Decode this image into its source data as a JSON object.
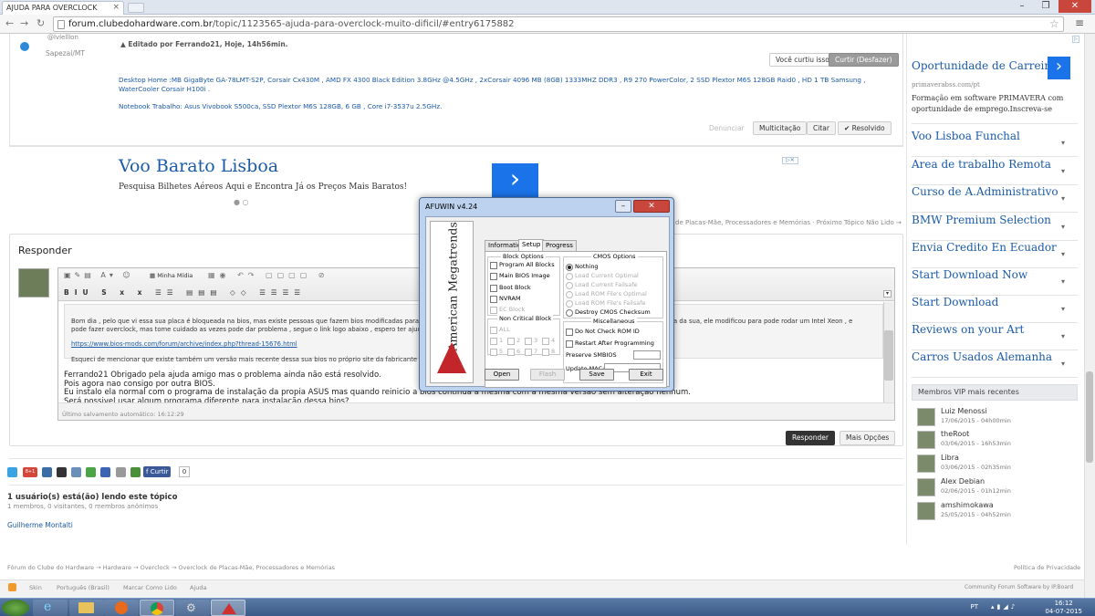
{
  "browser": {
    "tab_title": "AJUDA PARA OVERCLOCK",
    "url_host": "forum.clubedohardware.com.br",
    "url_path": "/topic/1123565-ajuda-para-overclock-muito-dificil/#entry6175882"
  },
  "post": {
    "user_fragment": "@lvlelllon",
    "location": "Sapezal/MT",
    "edited": "Editado por Ferrando21, Hoje, 14h56min.",
    "liked": "Você curtiu isso",
    "unlike": "Curtir (Desfazer)",
    "sig1": "Desktop Home :MB GigaByte GA-78LMT-S2P, Corsair Cx430M , AMD FX 4300 Black Edition 3.8GHz @4.5GHz , 2xCorsair 4096 MB (8GB) 1333MHZ DDR3 , R9 270 PowerColor, 2 SSD Plextor M6S 128GB Raid0 , HD 1 TB Samsung , WaterCooler Corsair H100i .",
    "sig2": "Notebook Trabalho: Asus Vivobook S500ca, SSD Plextor M6S 128GB, 6 GB , Core i7-3537u 2.5GHz.",
    "report": "Denunciar",
    "multiquote": "Multicitação",
    "quote": "Citar",
    "solved": "✔ Resolvido"
  },
  "ad1": {
    "title": "Voo Barato Lisboa",
    "text": "Pesquisa Bilhetes Aéreos Aqui e Encontra Já os Preços Mais Baratos!",
    "arrow": "›"
  },
  "nav_hint": "de Placas-Mãe, Processadores e Memórias · Próximo Tópico Não Lido →",
  "reply": {
    "heading": "Responder",
    "my_media": "Minha Mídia",
    "editor_p1": "Bom dia , pelo que vi essa sua placa é bloqueada na bios, mas existe pessoas que fazem bios modificadas para",
    "editor_p1b": "a da sua, ele modificou para pode rodar um Intel Xeon , e",
    "editor_p2": "pode fazer overclock, mas tome cuidado as vezes pode dar problema , segue o link logo abaixo , espero ter ajud",
    "editor_link": "https://www.bios-mods.com/forum/archive/index.php?thread-15676.html",
    "editor_p3": "Esqueci de mencionar que existe também um versão mais recente dessa sua bios no próprio site da fabricante d",
    "reply1": "Ferrando21 Obrigado pela ajuda amigo mas o problema ainda não está resolvido.",
    "reply2": "Pois agora nao consigo por outra BIOS.",
    "reply3": "Eu instalo ela normal com o programa de instalação da propia ASUS mas quando reinicio a bios continua a mesma com a mesma versão sem alteração nenhum.",
    "reply4": "Será possivel usar algum programa diferente para instalação dessa bios?",
    "autosave": "Último salvamento automático: 16:12:29",
    "submit": "Responder",
    "more": "Mais Opções"
  },
  "share": {
    "gplus": "8+1",
    "curtir": "Curtir",
    "count": "0"
  },
  "online": {
    "title": "1 usuário(s) está(ão) lendo este tópico",
    "detail": "1 membros, 0 visitantes, 0 membros anônimos",
    "user": "Guilherme Montalti"
  },
  "footer": {
    "breadcrumb": "Fórum do Clube do Hardware  →  Hardware  →  Overclock  →  Overclock de Placas-Mãe, Processadores e Memórias",
    "privacy": "Política de Privacidade",
    "skin": "Skin",
    "lang": "Português (Brasil)",
    "mark": "Marcar Como Lido",
    "help": "Ajuda",
    "powered": "Community Forum Software by IP.Board"
  },
  "sidebar": {
    "ad_title": "Oportunidade de Carreira",
    "ad_source": "primaverabss.com/pt",
    "ad_text": "Formação em software PRIMAVERA com oportunidade de emprego.Inscreva-se",
    "links": [
      "Voo Lisboa Funchal",
      "Area de trabalho Remota",
      "Curso de A.Administrativo",
      "BMW Premium Selection",
      "Envia Credito En Ecuador",
      "Start Download Now",
      "Start Download",
      "Reviews on your Art",
      "Carros Usados Alemanha"
    ],
    "vip_title": "Membros VIP mais recentes",
    "vip": [
      {
        "name": "Luiz Menossi",
        "date": "17/06/2015 - 04h00min"
      },
      {
        "name": "theRoot",
        "date": "03/06/2015 - 16h53min"
      },
      {
        "name": "Libra",
        "date": "03/06/2015 - 02h35min"
      },
      {
        "name": "Alex Debian",
        "date": "02/06/2015 - 01h12min"
      },
      {
        "name": "amshimokawa",
        "date": "25/05/2015 - 04h52min"
      }
    ]
  },
  "afuwin": {
    "title": "AFUWIN v4.24",
    "logo": "American Megatrends",
    "tabs": [
      "Information",
      "Setup",
      "Progress"
    ],
    "block_options": "Block Options",
    "block_items": [
      "Program All Blocks",
      "Main BIOS Image",
      "Boot Block",
      "NVRAM",
      "EC Block"
    ],
    "noncritical": "Non Critical Block",
    "all": "ALL",
    "nums": [
      "1",
      "2",
      "3",
      "4",
      "5",
      "6",
      "7",
      "8"
    ],
    "cmos_options": "CMOS Options",
    "cmos_items": [
      "Nothing",
      "Load Current Optimal",
      "Load Current Failsafe",
      "Load ROM File's Optimal",
      "Load ROM File's Failsafe",
      "Destroy CMOS Checksum"
    ],
    "misc": "Miscellaneous",
    "misc_items": [
      "Do Not Check ROM ID",
      "Restart After Programming"
    ],
    "preserve": "Preserve SMBIOS",
    "update_mac": "Update MAC:",
    "buttons": [
      "Open",
      "Flash",
      "Save",
      "Exit"
    ]
  },
  "taskbar": {
    "lang": "PT",
    "time": "16:12",
    "date": "04-07-2015"
  }
}
